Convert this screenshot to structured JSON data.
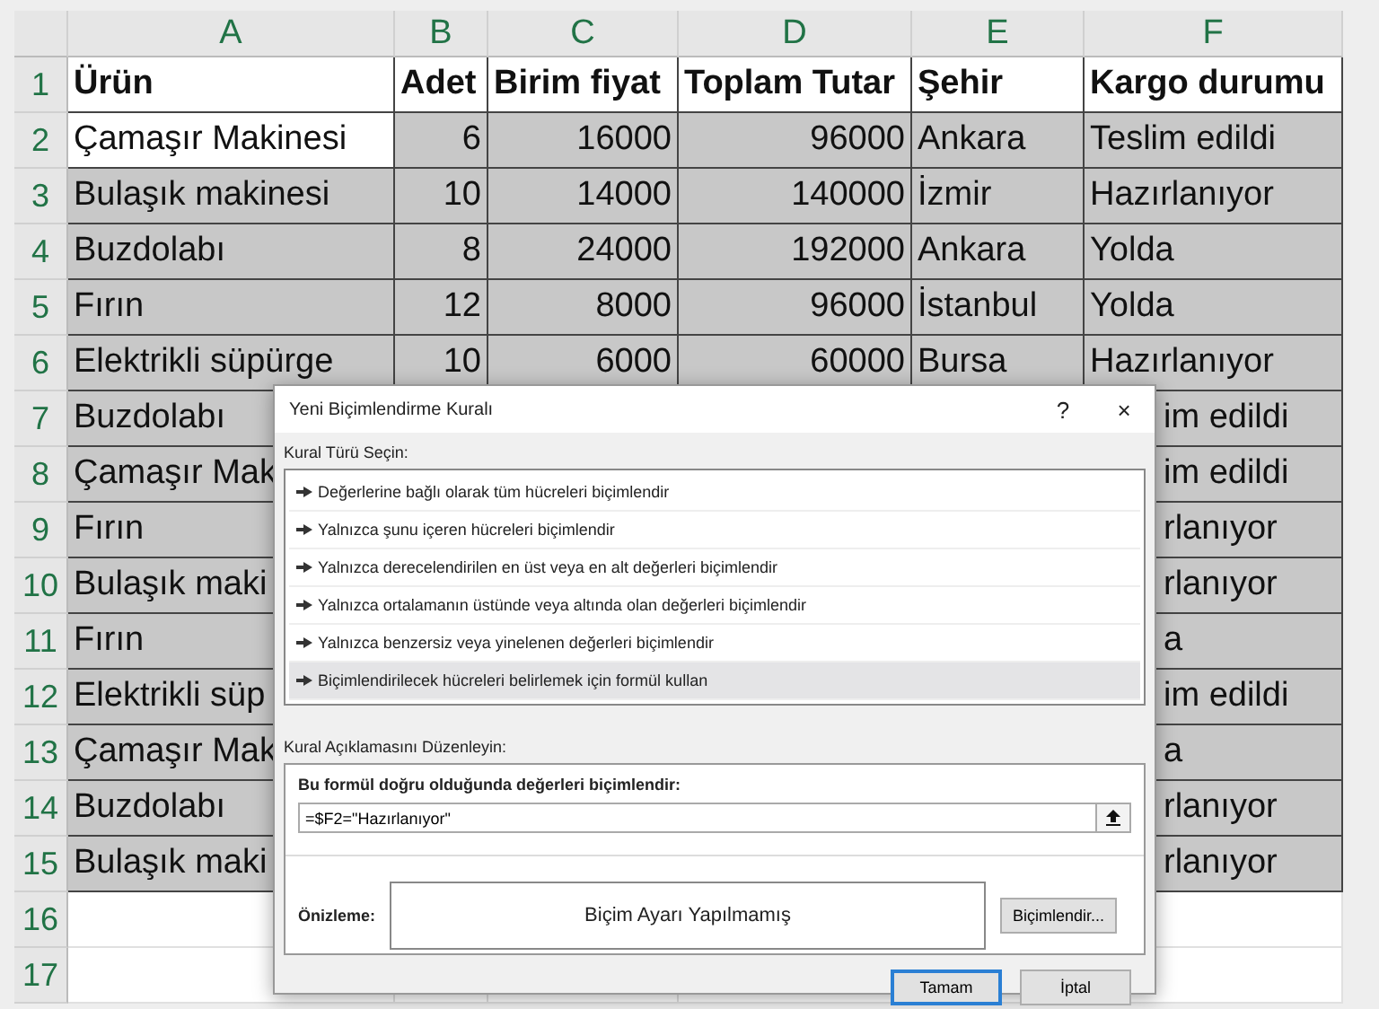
{
  "sheet": {
    "columns": [
      "A",
      "B",
      "C",
      "D",
      "E",
      "F"
    ],
    "rows": [
      {
        "number": "1",
        "kind": "header",
        "cells": [
          "Ürün",
          "Adet",
          "Birim fiyat",
          "Toplam Tutar",
          "Şehir",
          "Kargo durumu"
        ]
      },
      {
        "number": "2",
        "kind": "full",
        "active": true,
        "cells": [
          "Çamaşır Makinesi",
          "6",
          "16000",
          "96000",
          "Ankara",
          "Teslim edildi"
        ]
      },
      {
        "number": "3",
        "kind": "full",
        "active": false,
        "cells": [
          "Bulaşık makinesi",
          "10",
          "14000",
          "140000",
          "İzmir",
          "Hazırlanıyor"
        ]
      },
      {
        "number": "4",
        "kind": "full",
        "active": false,
        "cells": [
          "Buzdolabı",
          "8",
          "24000",
          "192000",
          "Ankara",
          "Yolda"
        ]
      },
      {
        "number": "5",
        "kind": "full",
        "active": false,
        "cells": [
          "Fırın",
          "12",
          "8000",
          "96000",
          "İstanbul",
          "Yolda"
        ]
      },
      {
        "number": "6",
        "kind": "full",
        "active": false,
        "cells": [
          "Elektrikli süpürge",
          "10",
          "6000",
          "60000",
          "Bursa",
          "Hazırlanıyor"
        ]
      },
      {
        "number": "7",
        "kind": "covered",
        "product": "Buzdolabı",
        "status": "im edildi"
      },
      {
        "number": "8",
        "kind": "covered",
        "product": "Çamaşır Mak",
        "status": "im edildi"
      },
      {
        "number": "9",
        "kind": "covered",
        "product": "Fırın",
        "status": "rlanıyor"
      },
      {
        "number": "10",
        "kind": "covered",
        "product": "Bulaşık maki",
        "status": "rlanıyor"
      },
      {
        "number": "11",
        "kind": "covered",
        "product": "Fırın",
        "status": "a"
      },
      {
        "number": "12",
        "kind": "covered",
        "product": "Elektrikli süp",
        "status": "im edildi"
      },
      {
        "number": "13",
        "kind": "covered",
        "product": "Çamaşır Mak",
        "status": "a"
      },
      {
        "number": "14",
        "kind": "covered",
        "product": "Buzdolabı",
        "status": "rlanıyor"
      },
      {
        "number": "15",
        "kind": "covered",
        "product": "Bulaşık maki",
        "status": "rlanıyor"
      },
      {
        "number": "16",
        "kind": "empty"
      },
      {
        "number": "17",
        "kind": "empty"
      }
    ]
  },
  "dialog": {
    "title": "Yeni Biçimlendirme Kuralı",
    "help": "?",
    "close": "×",
    "rule_type_label": "Kural Türü Seçin:",
    "rule_types": [
      {
        "label": "Değerlerine bağlı olarak tüm hücreleri biçimlendir",
        "selected": false
      },
      {
        "label": "Yalnızca şunu içeren hücreleri biçimlendir",
        "selected": false
      },
      {
        "label": "Yalnızca derecelendirilen en üst veya en alt değerleri biçimlendir",
        "selected": false
      },
      {
        "label": "Yalnızca ortalamanın üstünde veya altında olan değerleri biçimlendir",
        "selected": false
      },
      {
        "label": "Yalnızca benzersiz veya yinelenen değerleri biçimlendir",
        "selected": false
      },
      {
        "label": "Biçimlendirilecek hücreleri belirlemek için formül kullan",
        "selected": true
      }
    ],
    "description_label": "Kural Açıklamasını Düzenleyin:",
    "formula_label": "Bu formül doğru olduğunda değerleri biçimlendir:",
    "formula": "=$F2=\"Hazırlanıyor\"",
    "preview_label": "Önizleme:",
    "preview_text": "Biçim Ayarı Yapılmamış",
    "format_button": "Biçimlendir...",
    "ok_button": "Tamam",
    "cancel_button": "İptal"
  }
}
